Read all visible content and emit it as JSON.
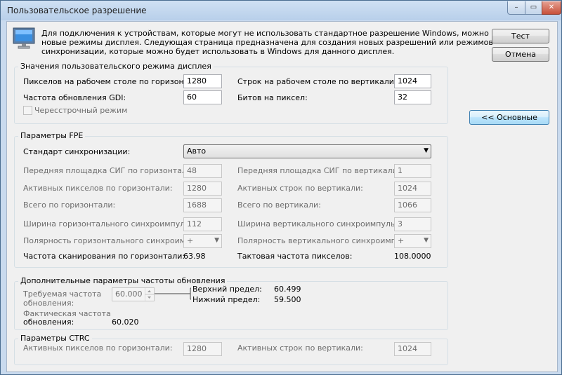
{
  "window": {
    "title": "Пользовательское разрешение"
  },
  "titlebar_buttons": {
    "minimize": "–",
    "maximize": "▭",
    "close": "✕"
  },
  "intro": {
    "line1": "Для подключения к устройствам, которые могут не использовать стандартное разрешение Windows, можно создать",
    "line2": "новые режимы дисплея. Следующая страница предназначена для создания новых разрешений или режимов",
    "line3": "синхронизации, которые можно будет использовать в Windows для данного дисплея."
  },
  "buttons": {
    "test": "Тест",
    "cancel": "Отмена",
    "basic": "<< Основные"
  },
  "custom_mode": {
    "title": "Значения пользовательского режима дисплея",
    "h_pixels_label": "Пикселов на рабочем столе по горизонтали:",
    "h_pixels": "1280",
    "v_lines_label": "Строк на рабочем столе по вертикали:",
    "v_lines": "1024",
    "refresh_label": "Частота обновления GDI:",
    "refresh": "60",
    "bits_label": "Битов на пиксел:",
    "bits": "32",
    "interlaced_label": "Чересстрочный режим"
  },
  "fpe": {
    "title": "Параметры FPE",
    "sync_std_label": "Стандарт синхронизации:",
    "sync_std": "Авто",
    "h_front_label": "Передняя площадка СИГ по горизонтали:",
    "h_front": "48",
    "v_front_label": "Передняя площадка СИГ по вертикали:",
    "v_front": "1",
    "h_active_label": "Активных пикселов по горизонтали:",
    "h_active": "1280",
    "v_active_label": "Активных строк по вертикали:",
    "v_active": "1024",
    "h_total_label": "Всего по горизонтали:",
    "h_total": "1688",
    "v_total_label": "Всего по вертикали:",
    "v_total": "1066",
    "h_sync_width_label": "Ширина горизонтального синхроимпульса:",
    "h_sync_width": "112",
    "v_sync_width_label": "Ширина вертикального синхроимпульса:",
    "v_sync_width": "3",
    "h_polarity_label": "Полярность горизонтального синхроимпульса:",
    "h_polarity": "+",
    "v_polarity_label": "Полярность вертикального синхроимпульса:",
    "v_polarity": "+",
    "h_scan_label": "Частота сканирования по горизонтали:",
    "h_scan": "63.98",
    "pixel_clock_label": "Тактовая частота пикселов:",
    "pixel_clock": "108.0000"
  },
  "refresh_params": {
    "title": "Дополнительные параметры частоты обновления",
    "required_label_1": "Требуемая частота",
    "required_label_2": "обновления:",
    "required": "60.000",
    "upper_label": "Верхний предел:",
    "upper": "60.499",
    "lower_label": "Нижний предел:",
    "lower": "59.500",
    "actual_label_1": "Фактическая частота",
    "actual_label_2": "обновления:",
    "actual": "60.020"
  },
  "ctrc": {
    "title": "Параметры CTRC",
    "h_active_label": "Активных пикселов по горизонтали:",
    "h_active": "1280",
    "v_active_label": "Активных строк по вертикали:",
    "v_active": "1024"
  },
  "icons": {
    "monitor": "monitor-icon",
    "dropdown": "chevron-down-icon"
  }
}
